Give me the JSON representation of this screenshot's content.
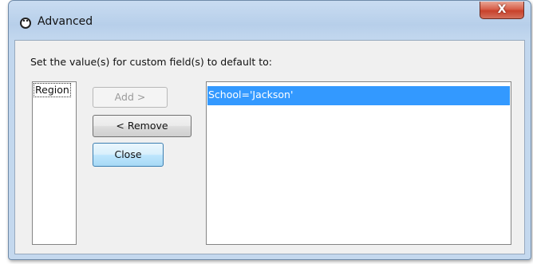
{
  "window": {
    "title": "Advanced",
    "close_glyph": "X"
  },
  "dialog": {
    "instruction": "Set the value(s) for custom field(s) to default to:",
    "available_fields": [
      "Region"
    ],
    "buttons": {
      "add": "Add >",
      "remove": "< Remove",
      "close": "Close"
    },
    "selected_values": [
      "School='Jackson'"
    ]
  },
  "colors": {
    "selection": "#3399ff",
    "titlebar": "#b7cfea",
    "close_button": "#c8412b"
  },
  "icons": {
    "app": "app-icon",
    "close": "close-icon"
  }
}
